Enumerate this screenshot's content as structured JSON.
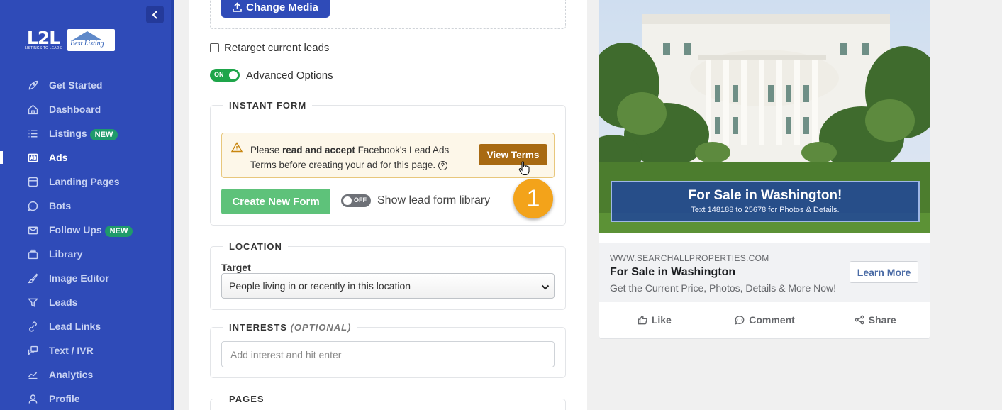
{
  "sidebar": {
    "logo": {
      "primary": "L2L",
      "tagline": "LISTINGS TO LEADS",
      "partner": "Best Listing"
    },
    "items": [
      {
        "label": "Get Started",
        "icon": "rocket-icon",
        "badge": ""
      },
      {
        "label": "Dashboard",
        "icon": "home-icon",
        "badge": ""
      },
      {
        "label": "Listings",
        "icon": "list-icon",
        "badge": "NEW"
      },
      {
        "label": "Ads",
        "icon": "ad-icon",
        "badge": "",
        "active": true
      },
      {
        "label": "Landing Pages",
        "icon": "page-icon",
        "badge": ""
      },
      {
        "label": "Bots",
        "icon": "chat-icon",
        "badge": ""
      },
      {
        "label": "Follow Ups",
        "icon": "mail-icon",
        "badge": "NEW"
      },
      {
        "label": "Library",
        "icon": "library-icon",
        "badge": ""
      },
      {
        "label": "Image Editor",
        "icon": "brush-icon",
        "badge": ""
      },
      {
        "label": "Leads",
        "icon": "filter-icon",
        "badge": ""
      },
      {
        "label": "Lead Links",
        "icon": "link-icon",
        "badge": ""
      },
      {
        "label": "Text / IVR",
        "icon": "message-icon",
        "badge": ""
      },
      {
        "label": "Analytics",
        "icon": "chart-icon",
        "badge": ""
      },
      {
        "label": "Profile",
        "icon": "user-icon",
        "badge": ""
      }
    ]
  },
  "form": {
    "change_media_label": "Change Media",
    "retarget_label": "Retarget current leads",
    "advanced": {
      "toggle_label": "ON",
      "label": "Advanced Options"
    },
    "instant_form": {
      "title": "INSTANT FORM",
      "alert_pre": "Please ",
      "alert_bold": "read and accept",
      "alert_post": " Facebook's Lead Ads Terms before creating your ad for this page.",
      "view_terms_label": "View Terms",
      "create_form_label": "Create New Form",
      "library_toggle_label": "OFF",
      "library_label": "Show lead form library",
      "step_number": "1"
    },
    "location": {
      "title": "LOCATION",
      "target_label": "Target",
      "target_value": "People living in or recently in this location"
    },
    "interests": {
      "title": "INTERESTS",
      "optional": "(OPTIONAL)",
      "placeholder": "Add interest and hit enter"
    },
    "pages": {
      "title": "PAGES"
    }
  },
  "preview": {
    "overlay_heading": "For Sale in Washington!",
    "overlay_sub": "Text 148188 to 25678 for Photos & Details.",
    "domain": "WWW.SEARCHALLPROPERTIES.COM",
    "title": "For Sale in Washington",
    "description": "Get the Current Price, Photos, Details & More Now!",
    "cta_label": "Learn More",
    "actions": {
      "like": "Like",
      "comment": "Comment",
      "share": "Share"
    }
  },
  "colors": {
    "sidebar": "#2f4bb8",
    "primary": "#2f4bb8",
    "warning_button": "#a86a12",
    "success_button": "#5ec27a",
    "toggle_on": "#1ea54a",
    "step_badge": "#f3a31a"
  }
}
